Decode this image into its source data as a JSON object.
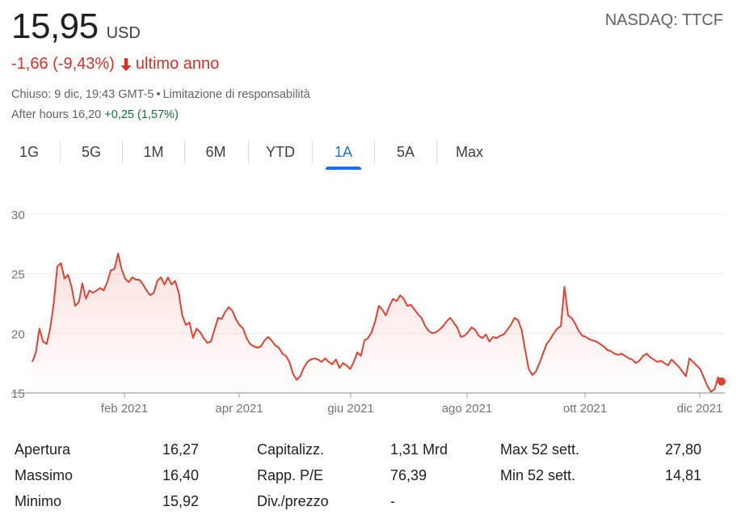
{
  "quote": {
    "price": "15,95",
    "currency": "USD",
    "exchange": "NASDAQ: TTCF",
    "change": "-1,66 (-9,43%)",
    "change_period": "ultimo anno",
    "closed_text": "Chiuso: 9 dic, 19:43 GMT-5",
    "disclaimer": "Limitazione di responsabilità",
    "after_hours_label": "After hours 16,20",
    "after_hours_change": "+0,25 (1,57%)"
  },
  "colors": {
    "negative": "#d93025",
    "positive": "#137333",
    "accent": "#1a73e8",
    "line": "#e2412f"
  },
  "icons": {
    "change_icon": "arrow-down-icon"
  },
  "tabs": [
    {
      "label": "1G",
      "active": false
    },
    {
      "label": "5G",
      "active": false
    },
    {
      "label": "1M",
      "active": false
    },
    {
      "label": "6M",
      "active": false
    },
    {
      "label": "YTD",
      "active": false
    },
    {
      "label": "1A",
      "active": true
    },
    {
      "label": "5A",
      "active": false
    },
    {
      "label": "Max",
      "active": false
    }
  ],
  "chart_data": {
    "type": "area",
    "x_ticks": [
      "feb 2021",
      "apr 2021",
      "giu 2021",
      "ago 2021",
      "ott 2021",
      "dic 2021"
    ],
    "y_ticks": [
      "30",
      "25",
      "20",
      "15"
    ],
    "ylim": [
      15,
      30
    ],
    "grid": "horizontal",
    "series": [
      {
        "values": [
          17.6,
          18.4,
          20.4,
          19.3,
          19.1,
          20.4,
          22.5,
          25.6,
          25.9,
          24.6,
          24.9,
          23.9,
          22.3,
          22.6,
          24.2,
          22.9,
          23.6,
          23.4,
          23.6,
          23.8,
          23.6,
          24.3,
          25.3,
          25.4,
          26.7,
          25.4,
          24.6,
          24.3,
          24.7,
          24.5,
          24.5,
          24.1,
          23.6,
          23.2,
          23.4,
          24.4,
          24.7,
          24.1,
          24.7,
          24.1,
          24.4,
          23.4,
          21.5,
          20.7,
          20.9,
          19.6,
          20.4,
          20.1,
          19.6,
          19.2,
          19.3,
          20.3,
          21.3,
          21.2,
          21.8,
          22.2,
          21.9,
          21.2,
          20.7,
          20.4,
          19.6,
          19.1,
          18.9,
          18.8,
          18.9,
          19.4,
          19.7,
          19.4,
          19.0,
          18.8,
          18.3,
          18.1,
          17.6,
          16.6,
          16.1,
          16.4,
          17.1,
          17.6,
          17.8,
          17.9,
          17.8,
          17.6,
          17.9,
          17.6,
          17.4,
          17.8,
          17.1,
          17.5,
          17.3,
          17.0,
          17.6,
          18.4,
          18.1,
          19.4,
          19.6,
          20.1,
          21.0,
          22.3,
          22.0,
          21.5,
          22.3,
          22.9,
          22.7,
          23.2,
          22.9,
          22.3,
          22.4,
          22.0,
          21.6,
          21.3,
          20.6,
          20.2,
          20.0,
          20.1,
          20.3,
          20.6,
          21.0,
          21.3,
          20.9,
          20.5,
          19.7,
          19.8,
          20.1,
          20.5,
          20.3,
          19.8,
          19.6,
          19.9,
          19.3,
          19.7,
          19.6,
          19.8,
          19.9,
          20.3,
          20.7,
          21.3,
          21.1,
          20.3,
          18.6,
          17.0,
          16.5,
          16.8,
          17.5,
          18.3,
          19.1,
          19.5,
          20.0,
          20.4,
          20.6,
          23.9,
          21.5,
          21.3,
          20.8,
          20.2,
          19.8,
          19.7,
          19.5,
          19.4,
          19.3,
          19.1,
          18.9,
          18.6,
          18.5,
          18.3,
          18.2,
          18.3,
          18.1,
          17.9,
          17.8,
          17.5,
          17.7,
          18.1,
          18.3,
          18.0,
          17.8,
          17.6,
          17.7,
          17.5,
          17.3,
          17.8,
          17.5,
          17.2,
          16.8,
          16.4,
          17.9,
          17.6,
          17.3,
          17.0,
          16.3,
          15.6,
          15.1,
          15.3,
          16.3,
          15.95
        ]
      }
    ]
  },
  "stats": [
    {
      "label": "Apertura",
      "value": "16,27"
    },
    {
      "label": "Massimo",
      "value": "16,40"
    },
    {
      "label": "Minimo",
      "value": "15,92"
    },
    {
      "label": "Capitalizz.",
      "value": "1,31 Mrd"
    },
    {
      "label": "Rapp. P/E",
      "value": "76,39"
    },
    {
      "label": "Div./prezzo",
      "value": "-"
    },
    {
      "label": "Max 52 sett.",
      "value": "27,80"
    },
    {
      "label": "Min 52 sett.",
      "value": "14,81"
    }
  ]
}
